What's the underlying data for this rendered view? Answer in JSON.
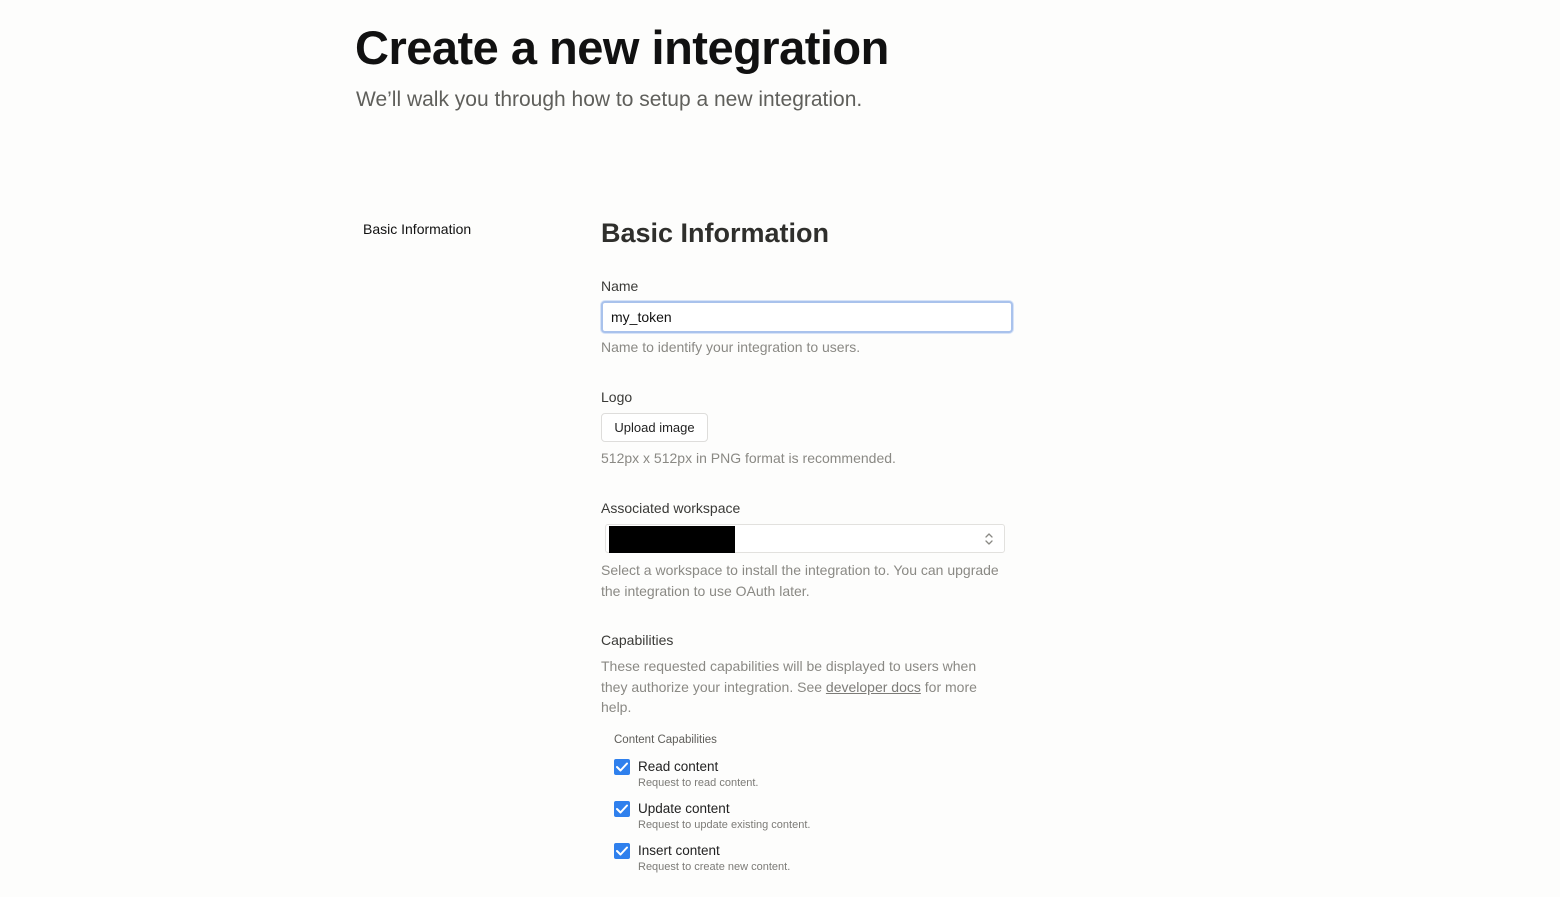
{
  "page": {
    "title": "Create a new integration",
    "subtitle": "We’ll walk you through how to setup a new integration."
  },
  "side_nav": {
    "items": [
      {
        "label": "Basic Information"
      }
    ]
  },
  "basic_info": {
    "heading": "Basic Information",
    "name": {
      "label": "Name",
      "value": "my_token",
      "help": "Name to identify your integration to users."
    },
    "logo": {
      "label": "Logo",
      "button_label": "Upload image",
      "help": "512px x 512px in PNG format is recommended."
    },
    "workspace": {
      "label": "Associated workspace",
      "selected_value": "[redacted]",
      "help": "Select a workspace to install the integration to. You can upgrade the integration to use OAuth later."
    },
    "capabilities": {
      "label": "Capabilities",
      "help_before_link": "These requested capabilities will be displayed to users when they authorize your integration. See ",
      "help_link": "developer docs",
      "help_after_link": " for more help.",
      "content_heading": "Content Capabilities",
      "items": [
        {
          "title": "Read content",
          "description": "Request to read content.",
          "checked": true
        },
        {
          "title": "Update content",
          "description": "Request to update existing content.",
          "checked": true
        },
        {
          "title": "Insert content",
          "description": "Request to create new content.",
          "checked": true
        }
      ]
    }
  },
  "colors": {
    "checkbox_accent": "#2f80ed",
    "input_focus_border": "#a9c2ec",
    "page_background": "#fdfdfc"
  },
  "icons": {
    "checkbox": "checkmark-icon",
    "select": "chevron-updown-icon"
  }
}
